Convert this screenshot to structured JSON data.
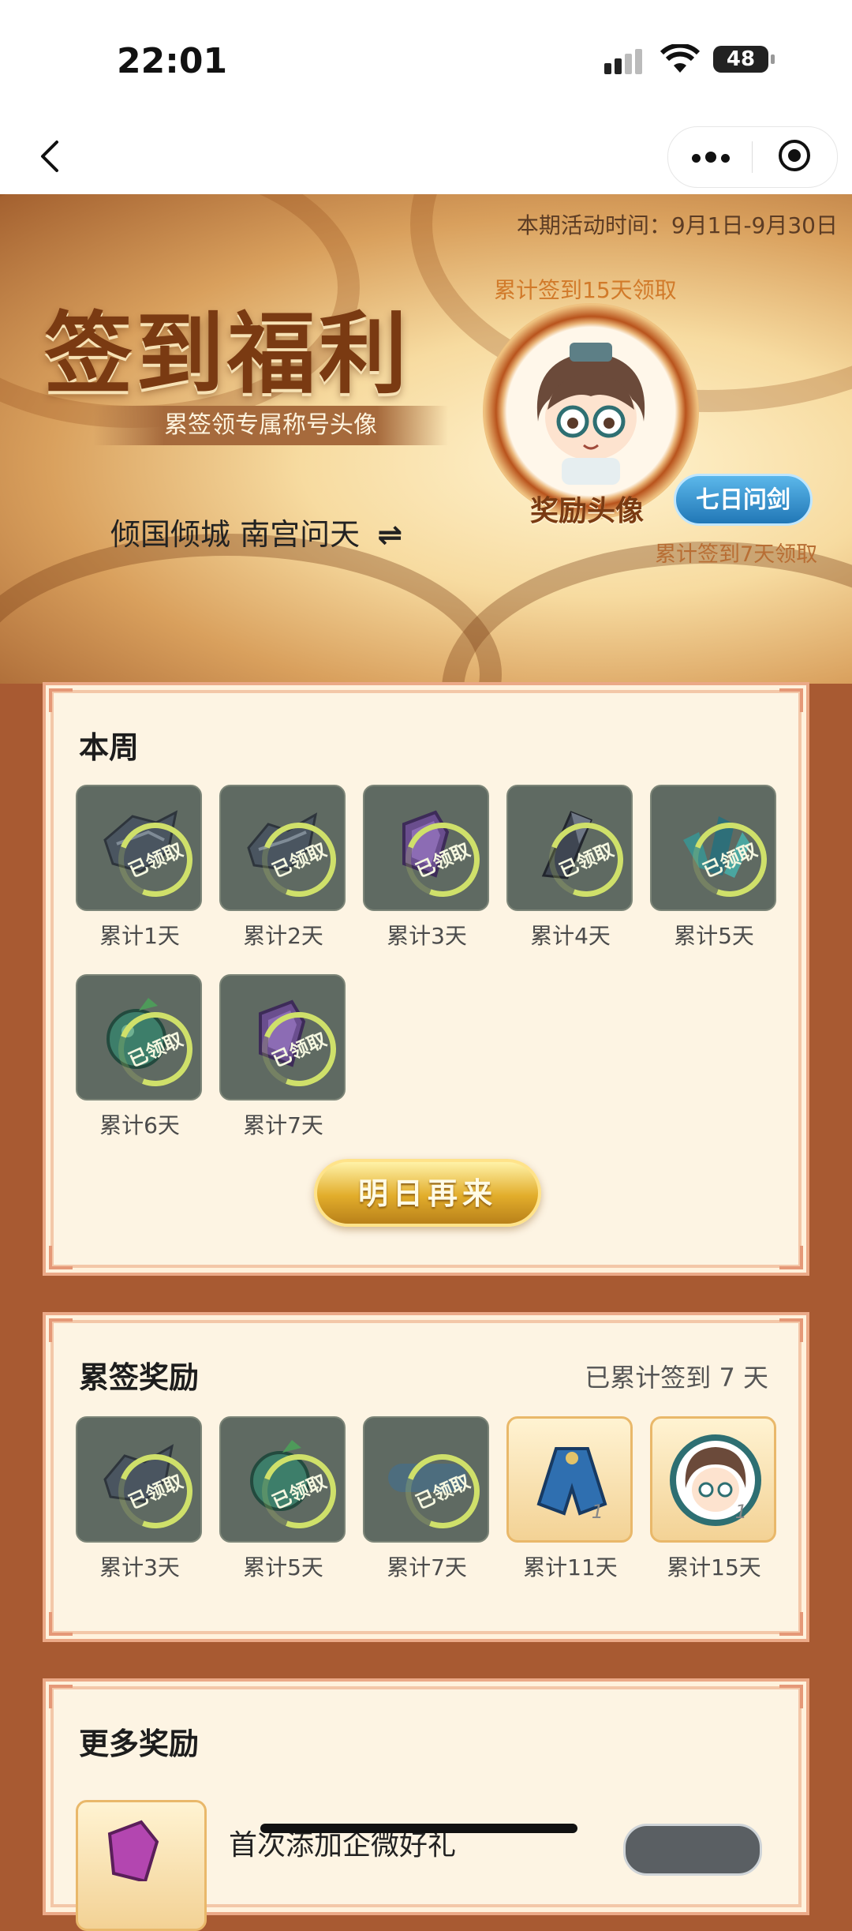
{
  "status_bar": {
    "time": "22:01",
    "battery": "48"
  },
  "banner": {
    "period": "本期活动时间：9月1日-9月30日",
    "title": "签到福利",
    "subtitle": "累签领专属称号头像",
    "user": "倾国倾城 南宫问天",
    "avatar_tip": "累计签到15天领取",
    "avatar_label": "奖励头像",
    "badge": "七日问剑",
    "badge_tip": "累计签到7天领取"
  },
  "week": {
    "title": "本周",
    "claimed_label": "已领取",
    "items": [
      {
        "label": "累计1天",
        "icon": "stone-shard-icon"
      },
      {
        "label": "累计2天",
        "icon": "stone-shard-icon"
      },
      {
        "label": "累计3天",
        "icon": "purple-crystal-icon"
      },
      {
        "label": "累计4天",
        "icon": "dark-crystal-icon"
      },
      {
        "label": "累计5天",
        "icon": "teal-crystal-icon"
      },
      {
        "label": "累计6天",
        "icon": "green-fruit-icon"
      },
      {
        "label": "累计7天",
        "icon": "purple-crystal-icon"
      }
    ],
    "button": "明日再来"
  },
  "cumulative": {
    "title": "累签奖励",
    "status": "已累计签到 7 天",
    "claimed_label": "已领取",
    "items": [
      {
        "label": "累计3天",
        "icon": "stone-shard-icon",
        "claimed": true
      },
      {
        "label": "累计5天",
        "icon": "green-fruit-icon",
        "claimed": true
      },
      {
        "label": "累计7天",
        "icon": "title-badge-icon",
        "claimed": true
      },
      {
        "label": "累计11天",
        "icon": "blue-cloak-icon",
        "qty": "1"
      },
      {
        "label": "累计15天",
        "icon": "avatar-frame-icon",
        "qty": "1"
      }
    ]
  },
  "more": {
    "title": "更多奖励",
    "first_row_text": "首次添加企微好礼"
  },
  "colors": {
    "accent": "#7a3a12",
    "card_border": "#eba987",
    "card_bg": "#fdf4e3",
    "claimed_ring": "#cfe06a"
  }
}
